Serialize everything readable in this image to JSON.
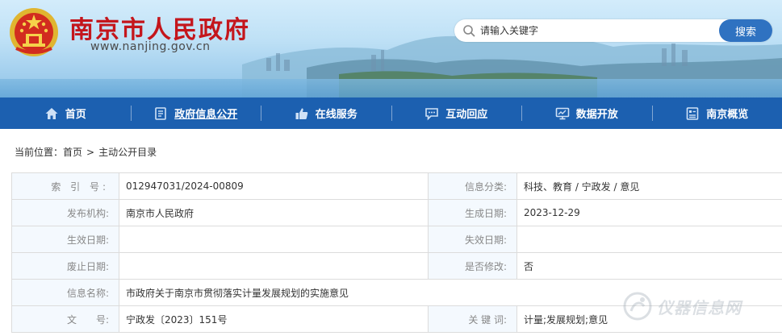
{
  "header": {
    "site_title": "南京市人民政府",
    "site_url": "www.nanjing.gov.cn",
    "search": {
      "placeholder": "请输入关键字",
      "button_label": "搜索"
    }
  },
  "nav": {
    "items": [
      {
        "label": "首页",
        "icon": "home-icon"
      },
      {
        "label": "政府信息公开",
        "icon": "document-icon",
        "active": true
      },
      {
        "label": "在线服务",
        "icon": "thumbs-up-icon"
      },
      {
        "label": "互动回应",
        "icon": "chat-icon"
      },
      {
        "label": "数据开放",
        "icon": "monitor-icon"
      },
      {
        "label": "南京概览",
        "icon": "list-icon"
      }
    ]
  },
  "breadcrumb": {
    "prefix": "当前位置：",
    "home": "首页",
    "separator": ">",
    "current": "主动公开目录"
  },
  "info": {
    "index_no_label": "索 引 号:",
    "index_no": "012947031/2024-00809",
    "category_label": "信息分类:",
    "category": "科技、教育 / 宁政发 / 意见",
    "publisher_label": "发布机构:",
    "publisher": "南京市人民政府",
    "created_label": "生成日期:",
    "created": "2023-12-29",
    "effective_label": "生效日期:",
    "effective": "",
    "expiry_label": "失效日期:",
    "expiry": "",
    "repeal_label": "废止日期:",
    "repeal": "",
    "modified_label": "是否修改:",
    "modified": "否",
    "name_label": "信息名称:",
    "name": "市政府关于南京市贯彻落实计量发展规划的实施意见",
    "doc_no_label": "文　　号:",
    "doc_no": "宁政发〔2023〕151号",
    "keywords_label": "关 键 词:",
    "keywords": "计量;发展规划;意见"
  },
  "watermark": {
    "text": "仪器信息网"
  },
  "colors": {
    "title_red": "#c4161c",
    "nav_blue": "#1c60b0",
    "search_button": "#2f72c1",
    "label_bg": "#f4f9fe"
  }
}
